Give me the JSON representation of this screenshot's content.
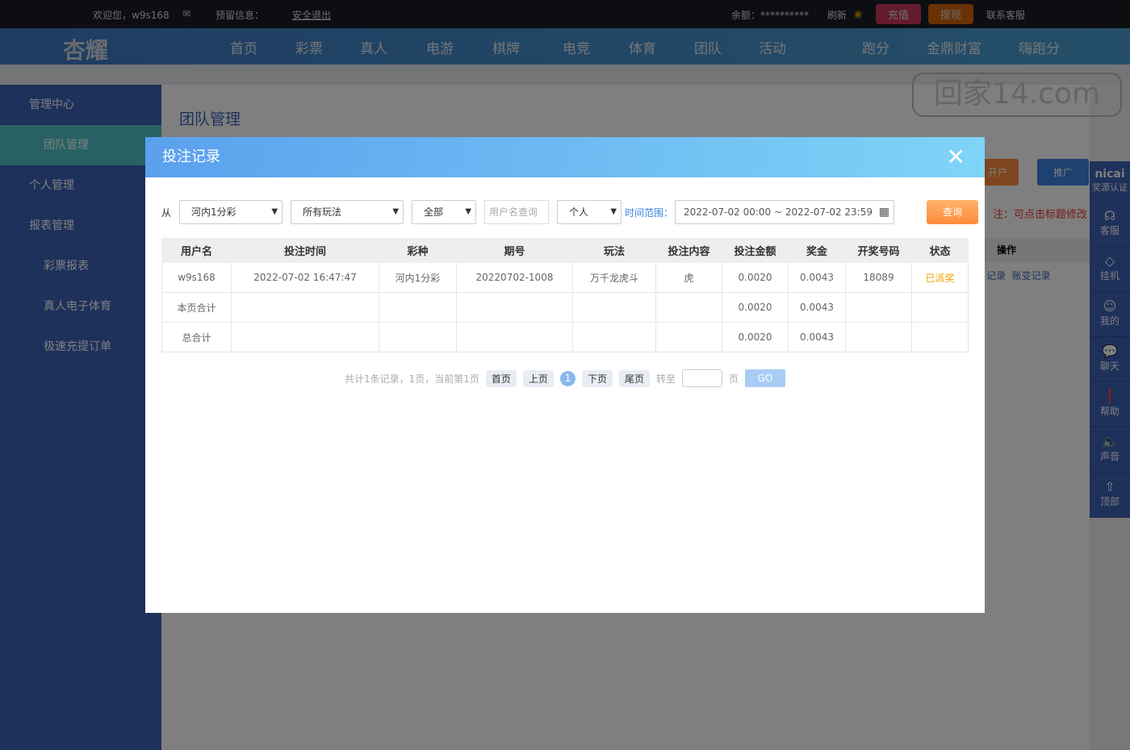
{
  "topbar": {
    "welcome": "欢迎您，w9s168",
    "reserved": "预留信息：",
    "logout": "安全退出",
    "balance": "余额：**********",
    "refresh": "刷新",
    "recharge": "充值",
    "withdraw": "提现",
    "service": "联系客服"
  },
  "nav": {
    "logo": "杏耀",
    "items": [
      "首页",
      "彩票",
      "真人",
      "电游",
      "棋牌",
      "电竞",
      "体育",
      "团队",
      "活动",
      "跑分",
      "金鼎财富",
      "嗨跑分"
    ]
  },
  "sidebar": {
    "items": [
      {
        "label": "管理中心"
      },
      {
        "label": "团队管理"
      },
      {
        "label": "个人管理"
      },
      {
        "label": "报表管理"
      },
      {
        "label": "彩票报表"
      },
      {
        "label": "真人电子体育"
      },
      {
        "label": "极速充提订单"
      }
    ]
  },
  "main": {
    "title": "团队管理",
    "open_account": "开户",
    "promote": "推广",
    "note": "注：可点击标题修改",
    "op_header": "操作",
    "links": [
      "记录",
      "账变记录"
    ]
  },
  "rightbar": {
    "badge": "nicai",
    "badge_sub": "奖源认证",
    "items": [
      "客服",
      "挂机",
      "我的",
      "聊天",
      "帮助",
      "声音",
      "顶部"
    ]
  },
  "watermark": "回家14.com",
  "modal": {
    "title": "投注记录",
    "from_label": "从",
    "lottery": "河内1分彩",
    "play": "所有玩法",
    "status": "全部",
    "username_placeholder": "用户名查询",
    "scope": "个人",
    "time_label": "时间范围：",
    "time_range": "2022-07-02 00:00 ~ 2022-07-02 23:59",
    "query": "查询",
    "headers": [
      "用户名",
      "投注时间",
      "彩种",
      "期号",
      "玩法",
      "投注内容",
      "投注金额",
      "奖金",
      "开奖号码",
      "状态"
    ],
    "rows": [
      [
        "w9s168",
        "2022-07-02 16:47:47",
        "河内1分彩",
        "20220702-1008",
        "万千龙虎斗",
        "虎",
        "0.0020",
        "0.0043",
        "18089",
        "已派奖"
      ],
      [
        "本页合计",
        "",
        "",
        "",
        "",
        "",
        "0.0020",
        "0.0043",
        "",
        ""
      ],
      [
        "总合计",
        "",
        "",
        "",
        "",
        "",
        "0.0020",
        "0.0043",
        "",
        ""
      ]
    ],
    "status_color": "#f0a000",
    "pager": {
      "summary": "共计1条记录，1页，当前第1页",
      "first": "首页",
      "prev": "上页",
      "current": "1",
      "next": "下页",
      "last": "尾页",
      "goto": "转至",
      "page": "页",
      "go": "GO"
    }
  }
}
